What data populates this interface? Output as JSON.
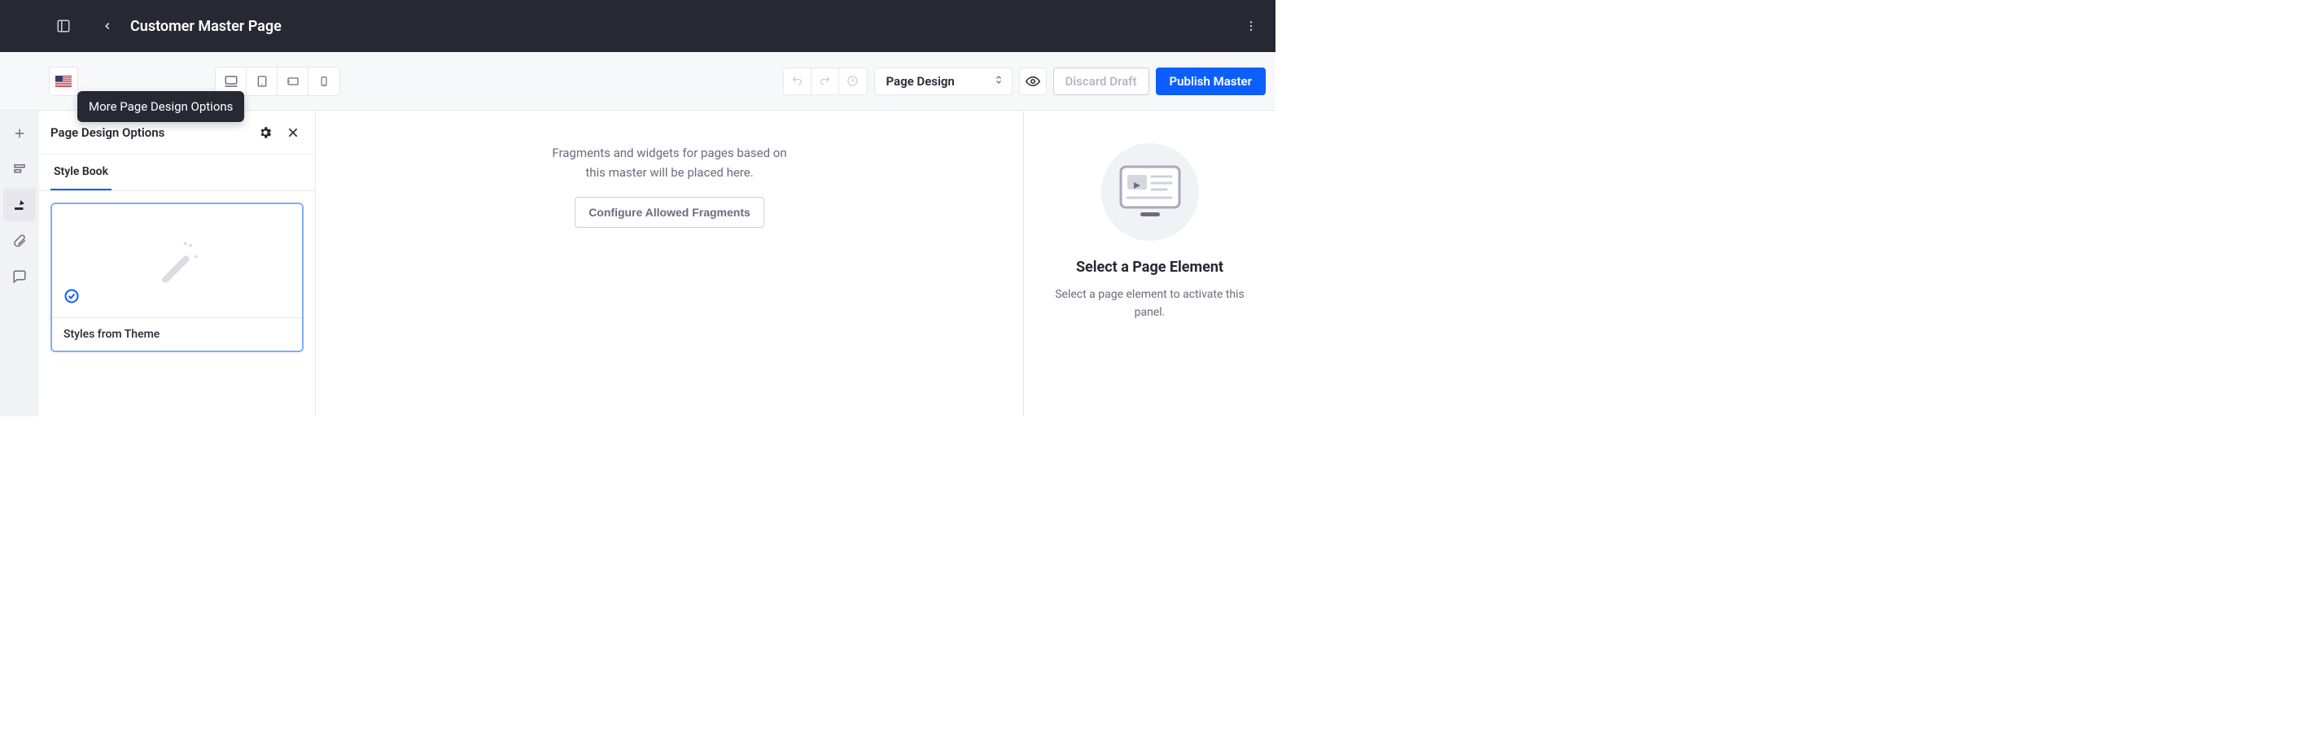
{
  "header": {
    "title": "Customer Master Page"
  },
  "toolbar": {
    "tooltip_more_options": "More Page Design Options",
    "select_label": "Page Design",
    "discard_label": "Discard Draft",
    "publish_label": "Publish Master"
  },
  "panel": {
    "title": "Page Design Options",
    "tabs": [
      "Style Book"
    ],
    "stylebook": {
      "label": "Styles from Theme"
    }
  },
  "canvas": {
    "placeholder_line1": "Fragments and widgets for pages based on",
    "placeholder_line2": "this master will be placed here.",
    "configure_label": "Configure Allowed Fragments"
  },
  "inspector": {
    "title": "Select a Page Element",
    "desc": "Select a page element to activate this panel."
  }
}
